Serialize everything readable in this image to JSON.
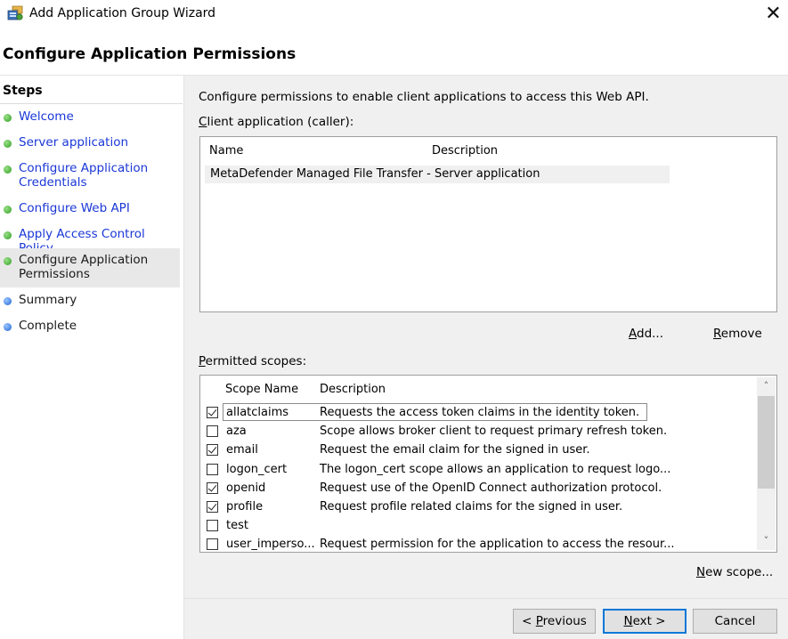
{
  "window": {
    "title": "Add Application Group Wizard",
    "close_glyph": "✕",
    "app_icon": "app-group-icon"
  },
  "header": {
    "title": "Configure Application Permissions"
  },
  "steps": {
    "title": "Steps",
    "items": [
      {
        "label": "Welcome",
        "status": "done"
      },
      {
        "label": "Server application",
        "status": "done"
      },
      {
        "label": "Configure Application Credentials",
        "status": "done"
      },
      {
        "label": "Configure Web API",
        "status": "done"
      },
      {
        "label": "Apply Access Control Policy",
        "status": "done"
      },
      {
        "label": "Configure Application Permissions",
        "status": "current"
      },
      {
        "label": "Summary",
        "status": "pending"
      },
      {
        "label": "Complete",
        "status": "pending"
      }
    ]
  },
  "main": {
    "intro": "Configure permissions to enable client applications to access this Web API.",
    "client_label_key": "C",
    "client_label_rest": "lient application (caller):",
    "client_columns": {
      "name": "Name",
      "description": "Description"
    },
    "client_rows": [
      {
        "name": "MetaDefender Managed File Transfer - Server application",
        "description": ""
      }
    ],
    "add_key": "A",
    "add_rest": "dd...",
    "remove_key": "R",
    "remove_rest": "emove",
    "scopes_label_key": "P",
    "scopes_label_rest": "ermitted scopes:",
    "scope_columns": {
      "name": "Scope Name",
      "description": "Description"
    },
    "scopes": [
      {
        "name": "allatclaims",
        "description": "Requests the access token claims in the identity token.",
        "checked": true
      },
      {
        "name": "aza",
        "description": "Scope allows broker client to request primary refresh token.",
        "checked": false
      },
      {
        "name": "email",
        "description": "Request the email claim for the signed in user.",
        "checked": true
      },
      {
        "name": "logon_cert",
        "description": "The logon_cert scope allows an application to request logo...",
        "checked": false
      },
      {
        "name": "openid",
        "description": "Request use of the OpenID Connect authorization protocol.",
        "checked": true
      },
      {
        "name": "profile",
        "description": "Request profile related claims for the signed in user.",
        "checked": true
      },
      {
        "name": "test",
        "description": "",
        "checked": false
      },
      {
        "name": "user_imperso...",
        "description": "Request permission for the application to access the resour...",
        "checked": false
      }
    ],
    "new_scope_key": "N",
    "new_scope_rest": "ew scope..."
  },
  "footer": {
    "previous_prefix": "< ",
    "previous_key": "P",
    "previous_rest": "revious",
    "next_key": "N",
    "next_rest": "ext >",
    "cancel": "Cancel"
  },
  "colors": {
    "link": "#1a37d6",
    "accent": "#0078d7",
    "done": "#2e9e1f",
    "pending": "#1d63d6"
  }
}
